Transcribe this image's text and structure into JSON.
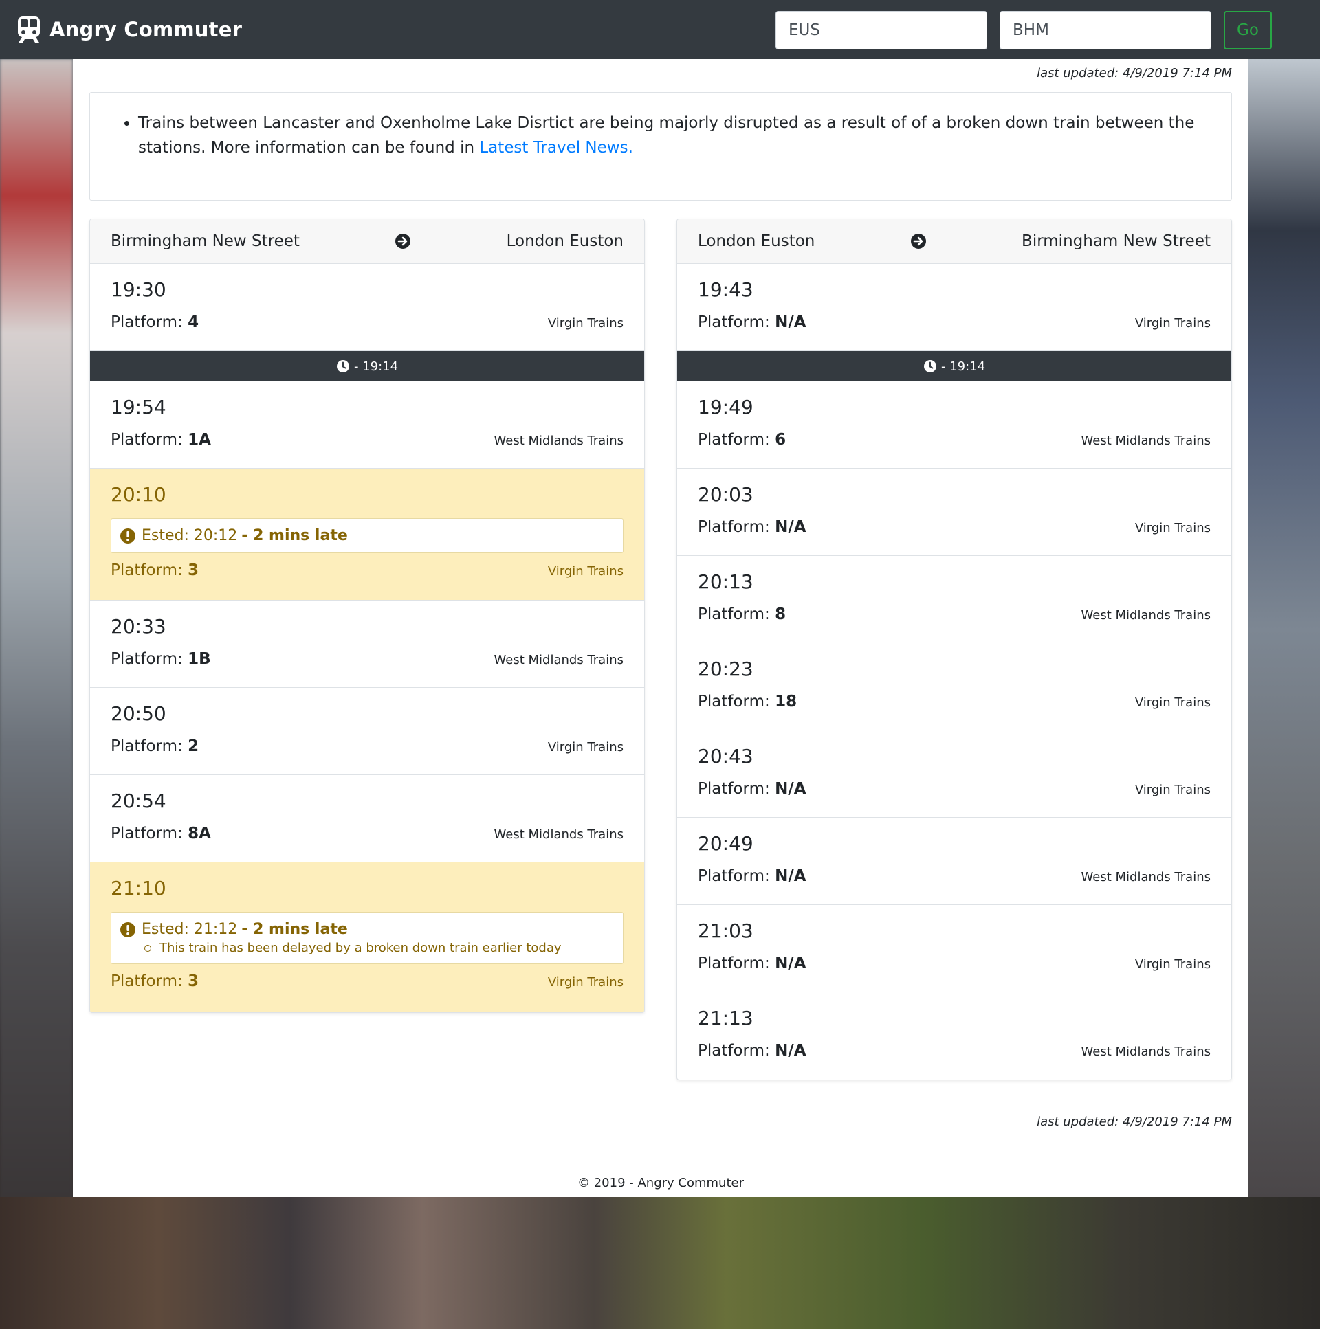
{
  "app": {
    "brand": "Angry Commuter"
  },
  "search": {
    "from": "EUS",
    "to": "BHM",
    "go_label": "Go"
  },
  "last_updated": "last updated: 4/9/2019 7:14 PM",
  "notice": {
    "text": "Trains between Lancaster and Oxenholme Lake Disrtict are being majorly disrupted as a result of of a broken down train between the stations. More information can be found in ",
    "link_label": "Latest Travel News."
  },
  "left_board": {
    "from": "Birmingham New Street",
    "to": "London Euston",
    "now_time": "- 19:14",
    "rows": [
      {
        "time": "19:30",
        "platform_label": "Platform:",
        "platform": "4",
        "operator": "Virgin Trains"
      },
      {
        "time": "19:54",
        "platform_label": "Platform:",
        "platform": "1A",
        "operator": "West Midlands Trains"
      },
      {
        "time": "20:10",
        "platform_label": "Platform:",
        "platform": "3",
        "operator": "Virgin Trains",
        "est": "Ested: 20:12",
        "late": "- 2 mins late"
      },
      {
        "time": "20:33",
        "platform_label": "Platform:",
        "platform": "1B",
        "operator": "West Midlands Trains"
      },
      {
        "time": "20:50",
        "platform_label": "Platform:",
        "platform": "2",
        "operator": "Virgin Trains"
      },
      {
        "time": "20:54",
        "platform_label": "Platform:",
        "platform": "8A",
        "operator": "West Midlands Trains"
      },
      {
        "time": "21:10",
        "platform_label": "Platform:",
        "platform": "3",
        "operator": "Virgin Trains",
        "est": "Ested: 21:12",
        "late": "- 2 mins late",
        "note": "This train has been delayed by a broken down train earlier today"
      }
    ]
  },
  "right_board": {
    "from": "London Euston",
    "to": "Birmingham New Street",
    "now_time": "- 19:14",
    "rows": [
      {
        "time": "19:43",
        "platform_label": "Platform:",
        "platform": "N/A",
        "operator": "Virgin Trains"
      },
      {
        "time": "19:49",
        "platform_label": "Platform:",
        "platform": "6",
        "operator": "West Midlands Trains"
      },
      {
        "time": "20:03",
        "platform_label": "Platform:",
        "platform": "N/A",
        "operator": "Virgin Trains"
      },
      {
        "time": "20:13",
        "platform_label": "Platform:",
        "platform": "8",
        "operator": "West Midlands Trains"
      },
      {
        "time": "20:23",
        "platform_label": "Platform:",
        "platform": "18",
        "operator": "Virgin Trains"
      },
      {
        "time": "20:43",
        "platform_label": "Platform:",
        "platform": "N/A",
        "operator": "Virgin Trains"
      },
      {
        "time": "20:49",
        "platform_label": "Platform:",
        "platform": "N/A",
        "operator": "West Midlands Trains"
      },
      {
        "time": "21:03",
        "platform_label": "Platform:",
        "platform": "N/A",
        "operator": "Virgin Trains"
      },
      {
        "time": "21:13",
        "platform_label": "Platform:",
        "platform": "N/A",
        "operator": "West Midlands Trains"
      }
    ]
  },
  "footer": {
    "copyright": "© 2019 - Angry Commuter"
  },
  "colors": {
    "navbar": "#343a40",
    "go_green": "#28a745",
    "link_blue": "#007bff",
    "delay_bg": "#fdeebc",
    "delay_text": "#856404"
  }
}
